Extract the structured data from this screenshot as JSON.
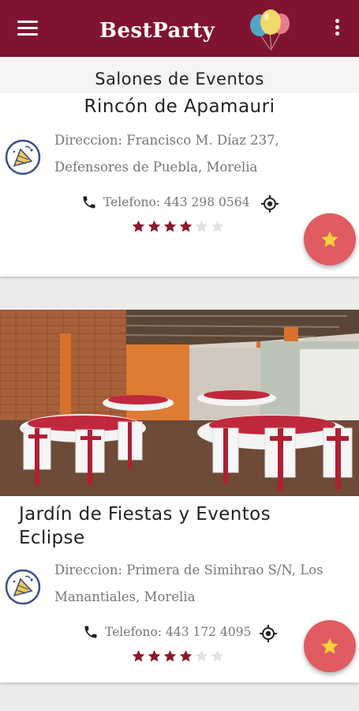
{
  "app": {
    "title": "BestParty"
  },
  "header": {
    "subtitle": "Salones de Eventos"
  },
  "colors": {
    "brand": "#7f1431",
    "fab": "#e05c62",
    "star_filled": "#8b1728",
    "star_empty": "#e2e2e2",
    "text_secondary": "#777777"
  },
  "venues": [
    {
      "name": "Rincón de Apamauri",
      "address": "Direccion: Francisco M. Díaz 237, Defensores de Puebla, Morelia",
      "phone": "Telefono: 443 298 0564",
      "rating": 4,
      "rating_max": 6
    },
    {
      "name": "Jardín de Fiestas y Eventos Eclipse",
      "address": "Direccion: Primera de Simihrao S/N, Los Manantiales, Morelia",
      "phone": "Telefono: 443 172 4095",
      "rating": 4,
      "rating_max": 6
    }
  ],
  "icons": {
    "menu": "menu-icon",
    "more": "more-vert-icon",
    "phone": "phone-icon",
    "location": "my-location-icon",
    "favorite": "star-icon",
    "hall": "party-hall-icon"
  }
}
